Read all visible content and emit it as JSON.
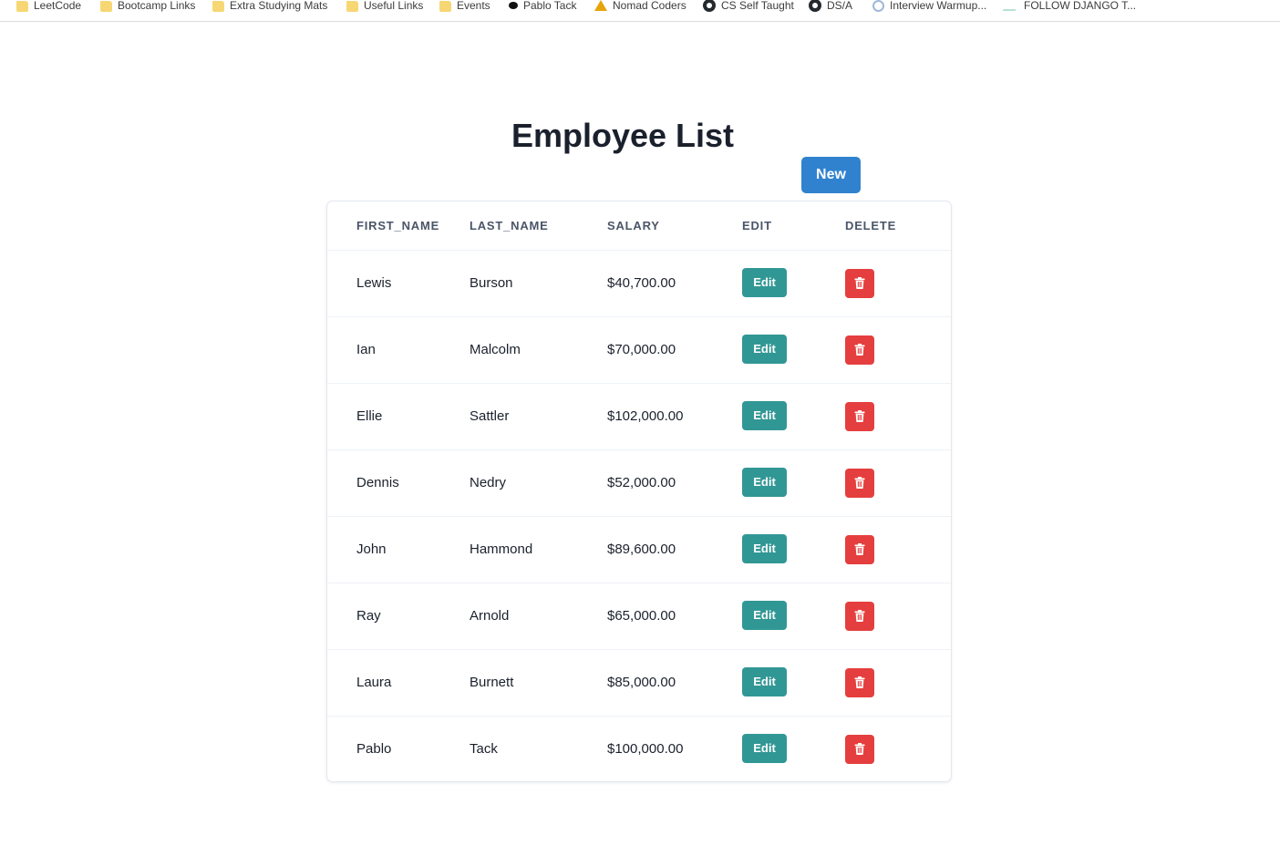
{
  "bookmarks": [
    {
      "label": "LeetCode",
      "icon": "folder-icon"
    },
    {
      "label": "Bootcamp Links",
      "icon": "folder-icon"
    },
    {
      "label": "Extra Studying Mats",
      "icon": "folder-icon"
    },
    {
      "label": "Useful Links",
      "icon": "folder-icon"
    },
    {
      "label": "Events",
      "icon": "folder-icon"
    },
    {
      "label": "Pablo Tack",
      "icon": "dot-icon"
    },
    {
      "label": "Nomad Coders",
      "icon": "nomad-icon"
    },
    {
      "label": "CS Self Taught",
      "icon": "github-icon"
    },
    {
      "label": "DS/A",
      "icon": "github-icon"
    },
    {
      "label": "Interview Warmup...",
      "icon": "interview-icon"
    },
    {
      "label": "FOLLOW DJANGO T...",
      "icon": "django-icon"
    }
  ],
  "page": {
    "title": "Employee List",
    "new_label": "New"
  },
  "table": {
    "headers": [
      "FIRST_NAME",
      "LAST_NAME",
      "SALARY",
      "EDIT",
      "DELETE"
    ],
    "edit_label": "Edit",
    "rows": [
      {
        "first": "Lewis",
        "last": "Burson",
        "salary": "$40,700.00"
      },
      {
        "first": "Ian",
        "last": "Malcolm",
        "salary": "$70,000.00"
      },
      {
        "first": "Ellie",
        "last": "Sattler",
        "salary": "$102,000.00"
      },
      {
        "first": "Dennis",
        "last": "Nedry",
        "salary": "$52,000.00"
      },
      {
        "first": "John",
        "last": "Hammond",
        "salary": "$89,600.00"
      },
      {
        "first": "Ray",
        "last": "Arnold",
        "salary": "$65,000.00"
      },
      {
        "first": "Laura",
        "last": "Burnett",
        "salary": "$85,000.00"
      },
      {
        "first": "Pablo",
        "last": "Tack",
        "salary": "$100,000.00"
      }
    ]
  },
  "colors": {
    "new_button": "#3182ce",
    "edit_button": "#319795",
    "delete_button": "#e53e3e"
  }
}
